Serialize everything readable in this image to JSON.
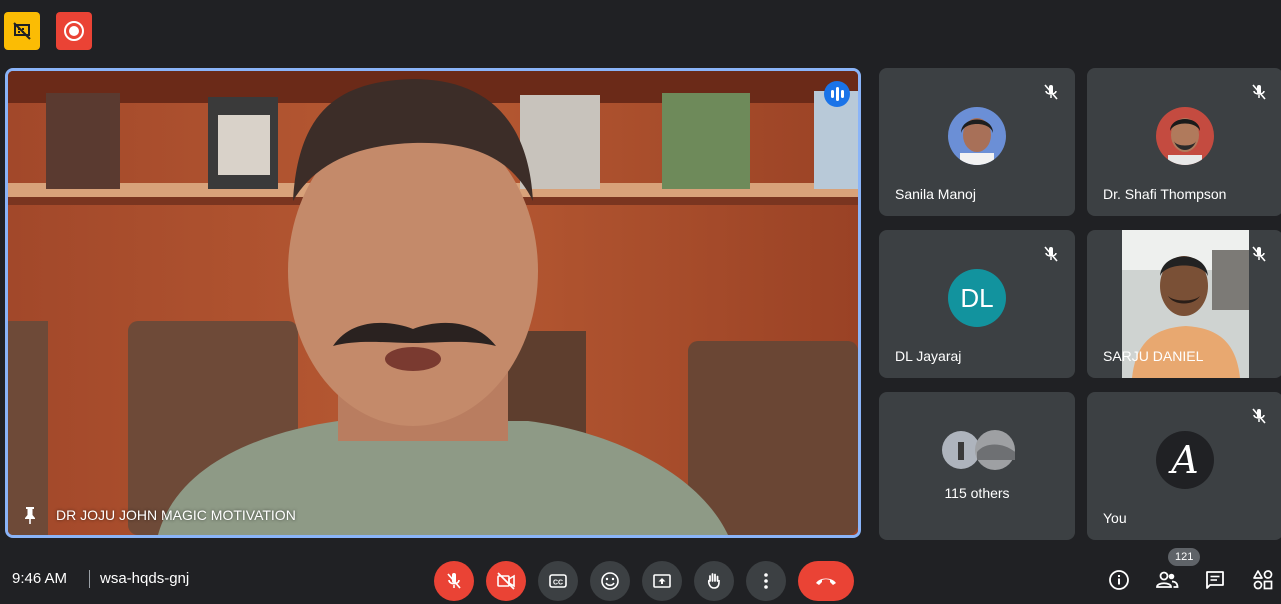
{
  "colors": {
    "background": "#202124",
    "tile": "#3c4043",
    "danger": "#ea4335",
    "accent": "#8ab4f8",
    "warning": "#fbbc04",
    "avatar_dl": "#12939e"
  },
  "top_indicators": [
    {
      "icon": "presentation-off-icon"
    },
    {
      "icon": "record-icon"
    }
  ],
  "main_tile": {
    "name": "DR JOJU JOHN MAGIC MOTIVATION",
    "icons": [
      "pin-icon",
      "speaking-indicator-icon"
    ]
  },
  "participants": [
    {
      "name": "Sanila Manoj",
      "muted": true,
      "avatar": "photo"
    },
    {
      "name": "Dr. Shafi Thompson",
      "muted": true,
      "avatar": "photo"
    },
    {
      "name": "DL Jayaraj",
      "muted": true,
      "initials": "DL"
    },
    {
      "name": "SARJU DANIEL",
      "muted": true,
      "avatar": "video"
    },
    {
      "others_label": "115 others"
    },
    {
      "name": "You",
      "muted": true,
      "initial": "A"
    }
  ],
  "bottom_bar": {
    "time": "9:46 AM",
    "meeting_code": "wsa-hqds-gnj",
    "controls": [
      "mic-off-icon",
      "camera-off-icon",
      "captions-icon",
      "emoji-icon",
      "present-icon",
      "raise-hand-icon",
      "more-options-icon",
      "end-call-icon"
    ],
    "side": [
      "info-icon",
      "people-icon",
      "chat-icon",
      "activities-icon"
    ],
    "people_count": "121"
  }
}
